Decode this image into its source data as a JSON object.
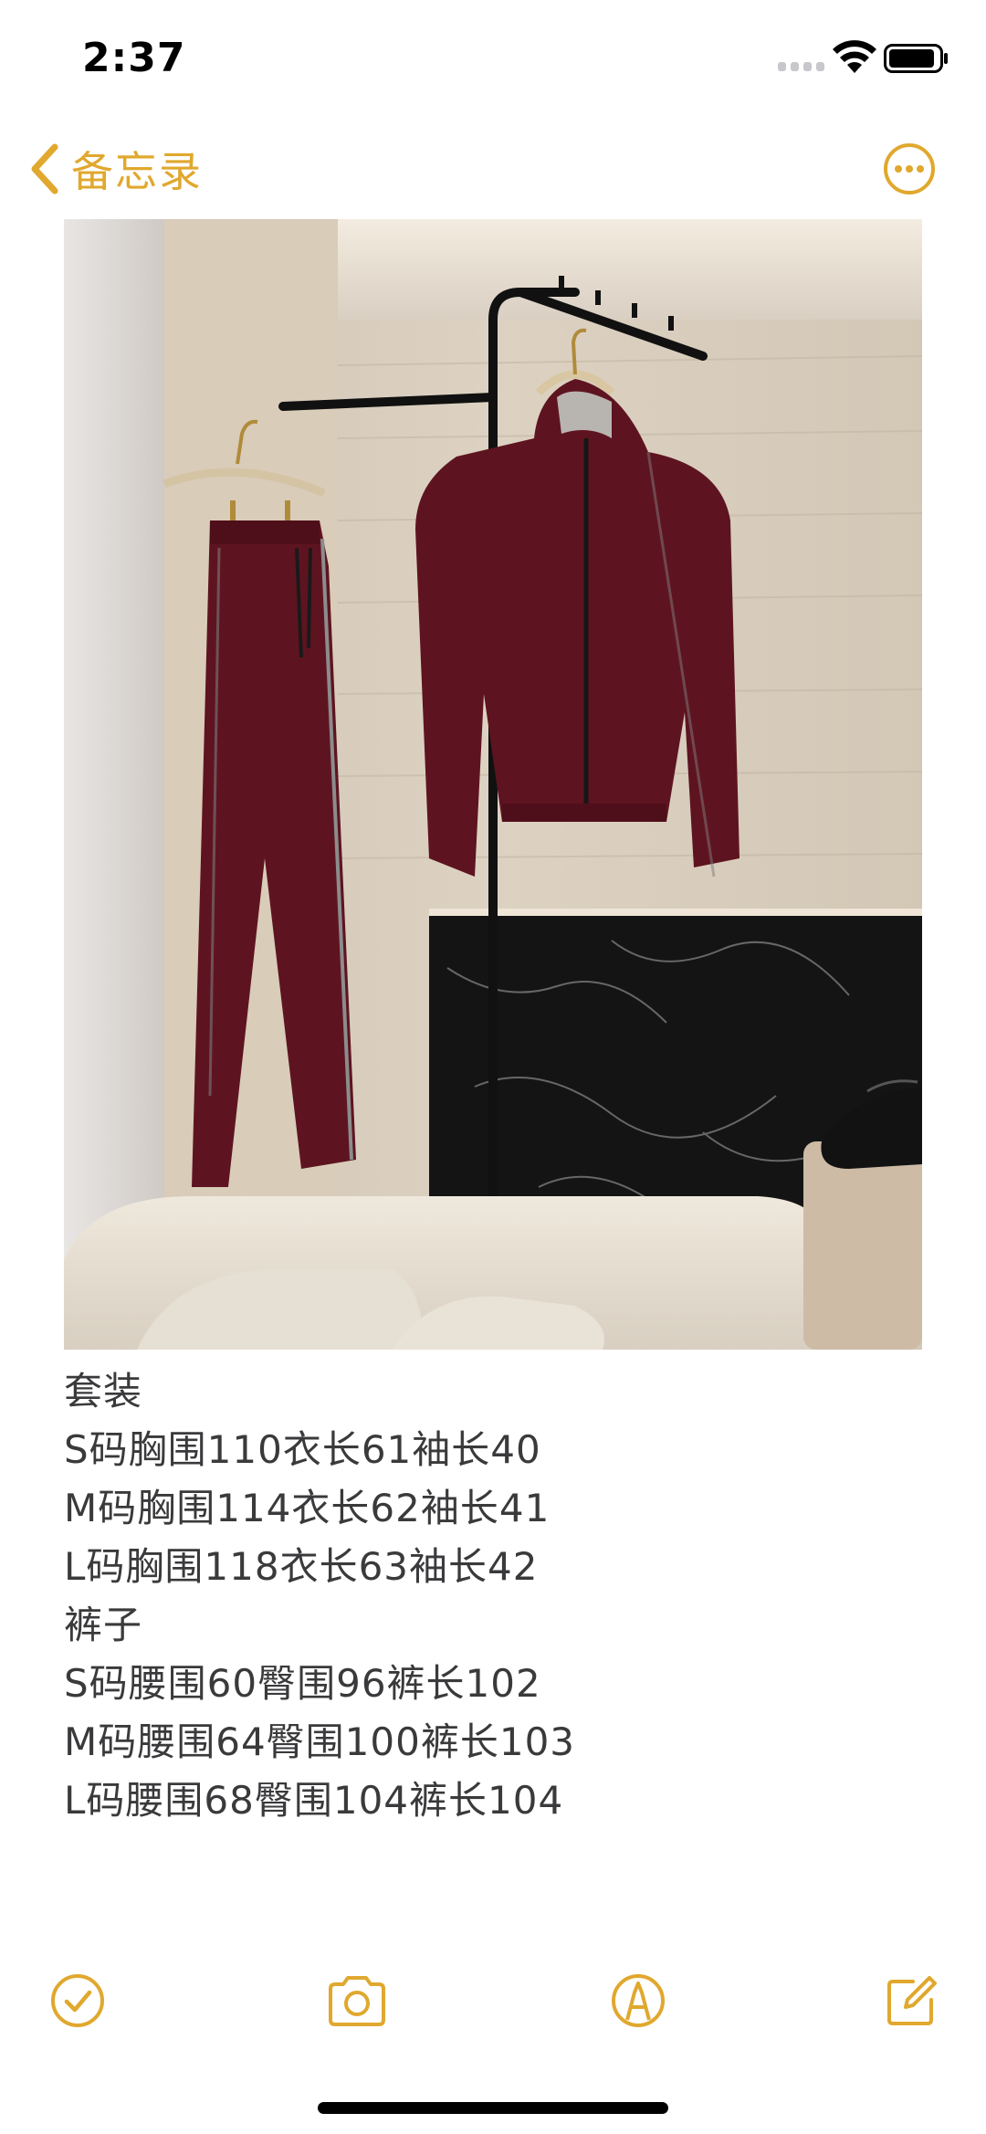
{
  "status_bar": {
    "time": "2:37"
  },
  "nav": {
    "back_label": "备忘录"
  },
  "note": {
    "lines": [
      "套装",
      "S码胸围110衣长61袖长40",
      "M码胸围114衣长62袖长41",
      "L码胸围118衣长63袖长42",
      "裤子",
      "S码腰围60臀围96裤长102",
      "M码腰围64臀围100裤长103",
      "L码腰围68臀围104裤长104"
    ]
  },
  "toolbar": {
    "items": [
      "checklist-icon",
      "camera-icon",
      "markup-icon",
      "compose-icon"
    ]
  },
  "colors": {
    "accent": "#e0a82e",
    "garment": "#5e1420"
  }
}
